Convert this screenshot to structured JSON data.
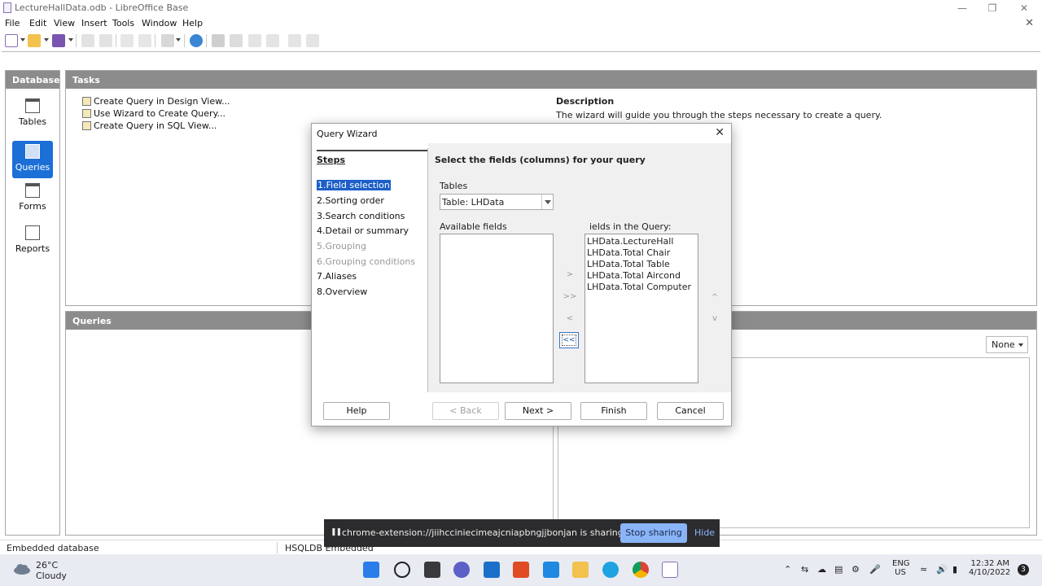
{
  "window": {
    "title": "LectureHallData.odb - LibreOffice Base"
  },
  "menubar": {
    "items": [
      "File",
      "Edit",
      "View",
      "Insert",
      "Tools",
      "Window",
      "Help"
    ]
  },
  "database_pane": {
    "header": "Database",
    "items": [
      {
        "label": "Tables",
        "icon": "table-icon",
        "active": false
      },
      {
        "label": "Queries",
        "icon": "query-icon",
        "active": true
      },
      {
        "label": "Forms",
        "icon": "form-icon",
        "active": false
      },
      {
        "label": "Reports",
        "icon": "report-icon",
        "active": false
      }
    ]
  },
  "tasks_pane": {
    "header": "Tasks",
    "items": [
      "Create Query in Design View...",
      "Use Wizard to Create Query...",
      "Create Query in SQL View..."
    ],
    "description_title": "Description",
    "description_text": "The wizard will guide you through the steps necessary to create a query."
  },
  "queries_pane": {
    "header": "Queries",
    "preview_select": "None"
  },
  "dialog": {
    "title": "Query Wizard",
    "steps_header": "Steps",
    "steps": [
      {
        "label": "1.Field selection",
        "state": "selected"
      },
      {
        "label": "2.Sorting order",
        "state": "normal"
      },
      {
        "label": "3.Search conditions",
        "state": "normal"
      },
      {
        "label": "4.Detail or summary",
        "state": "normal"
      },
      {
        "label": "5.Grouping",
        "state": "disabled"
      },
      {
        "label": "6.Grouping conditions",
        "state": "disabled"
      },
      {
        "label": "7.Aliases",
        "state": "normal"
      },
      {
        "label": "8.Overview",
        "state": "normal"
      }
    ],
    "heading": "Select the fields (columns) for your query",
    "tables_label": "Tables",
    "tables_value": "Table: LHData",
    "available_label": "Available fields",
    "query_fields_label": "ields in the Query:",
    "query_fields": [
      "LHData.LectureHall",
      "LHData.Total Chair",
      "LHData.Total Table",
      "LHData.Total Aircond",
      "LHData.Total Computer"
    ],
    "move_buttons": [
      ">",
      ">>",
      "<",
      "<<"
    ],
    "order_buttons": [
      "^",
      "v"
    ],
    "buttons": {
      "help": "Help",
      "back": "< Back",
      "next": "Next >",
      "finish": "Finish",
      "cancel": "Cancel"
    }
  },
  "statusbar": {
    "left": "Embedded database",
    "middle": "HSQLDB Embedded"
  },
  "share_banner": {
    "text": "chrome-extension://jiihcciniecimeajcniapbngjjbonjan is sharing your screen.",
    "stop": "Stop sharing",
    "hide": "Hide"
  },
  "taskbar": {
    "temp": "26°C",
    "condition": "Cloudy",
    "lang_line1": "ENG",
    "lang_line2": "US",
    "time": "12:32 AM",
    "date": "4/10/2022",
    "notifications": "3"
  },
  "colors": {
    "accent": "#1b6fd6",
    "pane_header": "#8c8c8c",
    "share_button": "#8ab4f8"
  }
}
